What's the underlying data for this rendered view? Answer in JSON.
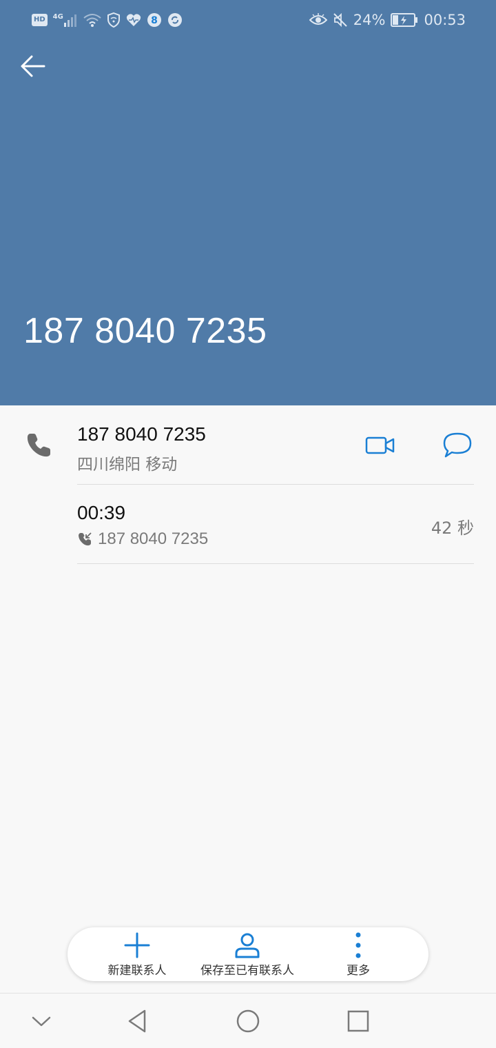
{
  "colors": {
    "header_bg": "#507ba8",
    "accent": "#1a7fd4",
    "text_primary": "#111111",
    "text_secondary": "#7a7a7a"
  },
  "status_bar": {
    "hd": "HD",
    "network": "4G",
    "battery": "24%",
    "time": "00:53",
    "icons": [
      "hd-icon",
      "signal-icon",
      "wifi-icon",
      "vpn-shield-icon",
      "health-heart-icon",
      "app-8-icon",
      "sync-icon",
      "eye-comfort-icon",
      "mute-icon",
      "battery-icon"
    ]
  },
  "header": {
    "title": "187 8040 7235"
  },
  "contact_row": {
    "number": "187 8040 7235",
    "location": "四川绵阳 移动"
  },
  "call_log": [
    {
      "time": "00:39",
      "number": "187 8040 7235",
      "duration": "42 秒"
    }
  ],
  "actions": {
    "new_contact": "新建联系人",
    "save_existing": "保存至已有联系人",
    "more": "更多"
  }
}
